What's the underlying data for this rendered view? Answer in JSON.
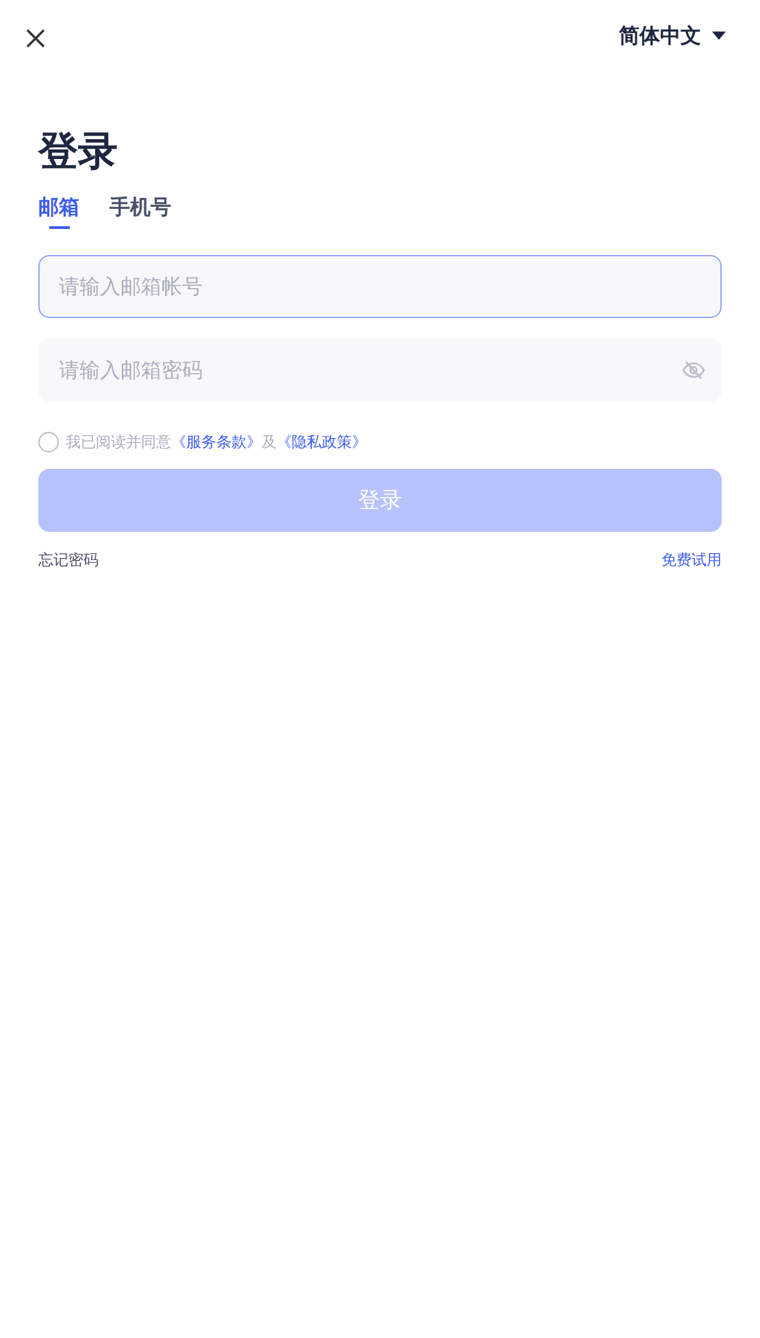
{
  "header": {
    "language": "简体中文"
  },
  "title": "登录",
  "tabs": [
    {
      "label": "邮箱",
      "selected": true
    },
    {
      "label": "手机号",
      "selected": false
    }
  ],
  "email_field": {
    "placeholder": "请输入邮箱帐号",
    "focused": true
  },
  "password_field": {
    "placeholder": "请输入邮箱密码",
    "password_visible": false
  },
  "agreement": {
    "checked": false,
    "text": "我已阅读并同意",
    "terms_link": "《服务条款》",
    "conjunction": "及",
    "privacy_link": "《隐私政策》"
  },
  "login_button": {
    "label": "登录",
    "disabled": true
  },
  "footer_links": {
    "forgot_password": "忘记密码",
    "free_trial": "免费试用"
  }
}
